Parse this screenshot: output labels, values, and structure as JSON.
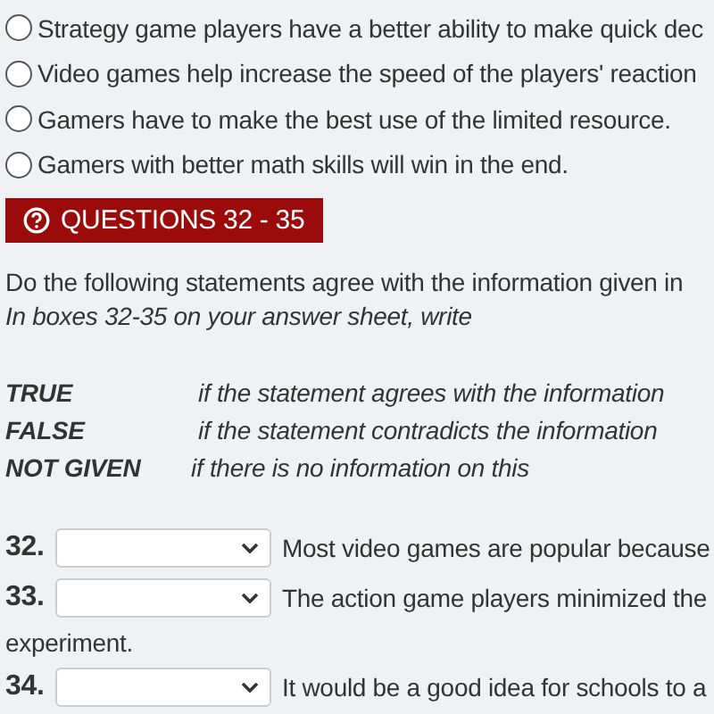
{
  "options": [
    {
      "label": "Strategy game players have a better ability to make quick dec",
      "selected": false
    },
    {
      "label": "Video games help increase the speed of the players' reaction",
      "selected": false
    },
    {
      "label": "Gamers have to make the best use of the limited resource.",
      "selected": false
    },
    {
      "label": "Gamers with better math skills will win in the end.",
      "selected": false
    }
  ],
  "section": {
    "title": "QUESTIONS 32 - 35"
  },
  "instruction": "Do the following statements agree with the information given in",
  "note": "In boxes 32-35 on your answer sheet, write",
  "legend": [
    {
      "term": "TRUE",
      "meaning": "if the statement agrees with the information"
    },
    {
      "term": "FALSE",
      "meaning": "if the statement contradicts the information"
    },
    {
      "term": "NOT GIVEN",
      "meaning": "if there is no information on this"
    }
  ],
  "questions": [
    {
      "number": "32.",
      "text": "Most video games are popular because"
    },
    {
      "number": "33.",
      "text": "The action game players minimized the",
      "continuation": "experiment."
    },
    {
      "number": "34.",
      "text": "It would be a good idea for schools to a"
    }
  ]
}
